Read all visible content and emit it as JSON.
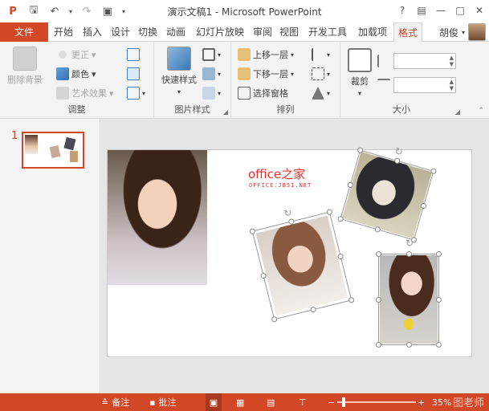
{
  "titlebar": {
    "title": "演示文稿1 - Microsoft PowerPoint",
    "help": "?",
    "min": "—",
    "max": "□",
    "close": "✕"
  },
  "tabs": [
    "文件",
    "开始",
    "插入",
    "设计",
    "切换",
    "动画",
    "幻灯片放映",
    "审阅",
    "视图",
    "开发工具",
    "加载项",
    "格式"
  ],
  "active_tab": "格式",
  "user": {
    "name": "胡俊"
  },
  "ribbon": {
    "adjust": {
      "label": "调整",
      "remove_bg": "删除背景",
      "corrections": "更正",
      "color": "颜色",
      "artistic": "艺术效果"
    },
    "styles": {
      "label": "图片样式",
      "quick_styles": "快速样式"
    },
    "arrange": {
      "label": "排列",
      "bring_forward": "上移一层",
      "send_backward": "下移一层",
      "selection_pane": "选择窗格"
    },
    "size": {
      "label": "大小",
      "crop": "裁剪",
      "height": "",
      "width": ""
    }
  },
  "slides": {
    "number": "1"
  },
  "slide": {
    "title": "office之家",
    "subtitle": "OFFICE.JB51.NET"
  },
  "status": {
    "notes": "备注",
    "comments": "批注",
    "zoom": "35%",
    "watermark": "图老师"
  },
  "colors": {
    "accent": "#d24726",
    "slide_title": "#e8312f"
  }
}
